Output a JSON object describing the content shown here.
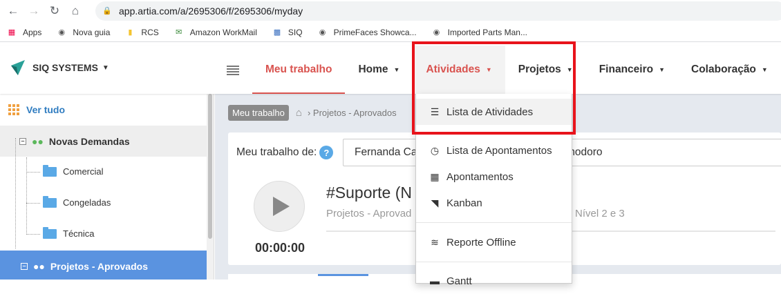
{
  "browser": {
    "url": "app.artia.com/a/2695306/f/2695306/myday",
    "bookmarks": [
      {
        "label": "Apps",
        "icon": "apps-grid-icon"
      },
      {
        "label": "Nova guia",
        "icon": "globe-icon"
      },
      {
        "label": "RCS",
        "icon": "folder-icon"
      },
      {
        "label": "Amazon WorkMail",
        "icon": "mail-icon"
      },
      {
        "label": "SIQ",
        "icon": "chart-icon"
      },
      {
        "label": "PrimeFaces Showca...",
        "icon": "primefaces-icon"
      },
      {
        "label": "Imported Parts Man...",
        "icon": "globe-icon"
      }
    ]
  },
  "header": {
    "brand": "SIQ SYSTEMS",
    "nav": [
      {
        "label": "Meu trabalho"
      },
      {
        "label": "Home"
      },
      {
        "label": "Atividades"
      },
      {
        "label": "Projetos"
      },
      {
        "label": "Financeiro"
      },
      {
        "label": "Colaboração"
      }
    ]
  },
  "sidebar": {
    "see_all": "Ver tudo",
    "group": "Novas Demandas",
    "folders": [
      "Comercial",
      "Congeladas",
      "Técnica"
    ],
    "selected": "Projetos - Aprovados"
  },
  "main": {
    "crumb_tag": "Meu trabalho",
    "crumb_path": "› Projetos - Aprovados",
    "work_label": "Meu trabalho de:",
    "help": "?",
    "user_value": "Fernanda Ca",
    "mode_value": "modoro",
    "task_title": "#Suporte (N",
    "task_path": "Projetos - Aprovad",
    "task_path_rest": "Nível 2 e 3",
    "timer": "00:00:00"
  },
  "dropdown": {
    "items": [
      {
        "label": "Lista de Atividades",
        "icon": "list-icon"
      },
      {
        "label": "Lista de Apontamentos",
        "icon": "clock-icon"
      },
      {
        "label": "Apontamentos",
        "icon": "calendar-grid-icon"
      },
      {
        "label": "Kanban",
        "icon": "kanban-icon"
      },
      {
        "label": "Reporte Offline",
        "icon": "offline-icon"
      },
      {
        "label": "Gantt",
        "icon": "gantt-icon"
      }
    ]
  },
  "colors": {
    "accent_red": "#d9534f",
    "highlight_box": "#e8131b",
    "selected_blue": "#5a93e0"
  }
}
